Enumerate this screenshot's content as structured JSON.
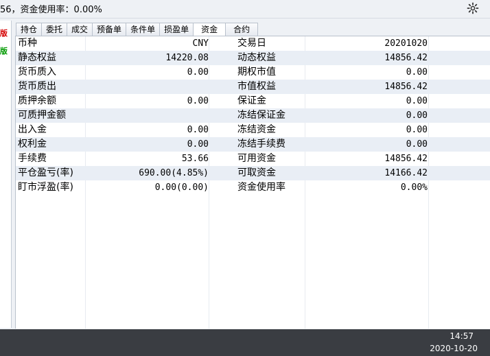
{
  "topbar": {
    "status_text": "56，资金使用率：0.00%"
  },
  "leftstrip": {
    "marks": [
      {
        "text": "版",
        "color": "#d40000"
      },
      {
        "text": "版",
        "color": "#009a00"
      }
    ]
  },
  "tabs": [
    {
      "label": "持仓"
    },
    {
      "label": "委托"
    },
    {
      "label": "成交"
    },
    {
      "label": "预备单"
    },
    {
      "label": "条件单"
    },
    {
      "label": "损盈单"
    },
    {
      "label": "资金",
      "active": true
    },
    {
      "label": "合约"
    }
  ],
  "rows": [
    {
      "label1": "币种",
      "value1": "CNY",
      "label2": "交易日",
      "value2": "20201020"
    },
    {
      "label1": "静态权益",
      "value1": "14220.08",
      "label2": "动态权益",
      "value2": "14856.42"
    },
    {
      "label1": "货币质入",
      "value1": "0.00",
      "label2": "期权市值",
      "value2": "0.00"
    },
    {
      "label1": "货币质出",
      "value1": "",
      "label2": "市值权益",
      "value2": "14856.42"
    },
    {
      "label1": "质押余额",
      "value1": "0.00",
      "label2": "保证金",
      "value2": "0.00"
    },
    {
      "label1": "可质押金额",
      "value1": "",
      "label2": "冻结保证金",
      "value2": "0.00"
    },
    {
      "label1": "出入金",
      "value1": "0.00",
      "label2": "冻结资金",
      "value2": "0.00"
    },
    {
      "label1": "权利金",
      "value1": "0.00",
      "label2": "冻结手续费",
      "value2": "0.00"
    },
    {
      "label1": "手续费",
      "value1": "53.66",
      "label2": "可用资金",
      "value2": "14856.42"
    },
    {
      "label1": "平仓盈亏(率)",
      "value1": "690.00(4.85%)",
      "label2": "可取资金",
      "value2": "14166.42"
    },
    {
      "label1": "盯市浮盈(率)",
      "value1": "0.00(0.00)",
      "label2": "资金使用率",
      "value2": "0.00%"
    }
  ],
  "taskbar": {
    "time": "14:57",
    "date": "2020-10-20"
  },
  "colors": {
    "row_stripe": "#e9eef5",
    "taskbar": "#3a3d42"
  }
}
